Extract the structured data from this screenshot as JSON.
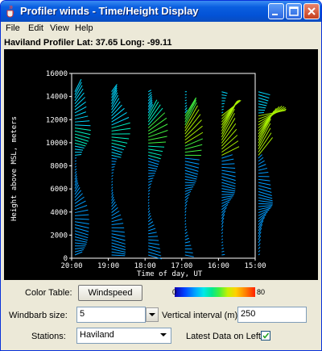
{
  "window": {
    "title": "Profiler winds - Time/Height Display"
  },
  "menu": {
    "file": "File",
    "edit": "Edit",
    "view": "View",
    "help": "Help"
  },
  "station_line": "Haviland Profiler Lat: 37.65  Long: -99.11",
  "plot": {
    "y_axis_label": "Height above MSL, meters",
    "x_axis_label": "Time of day, UT",
    "y_ticks": [
      "0",
      "2000",
      "4000",
      "6000",
      "8000",
      "10000",
      "12000",
      "14000",
      "16000"
    ],
    "x_ticks": [
      "20:00",
      "19:00",
      "18:00",
      "17:00",
      "16:00",
      "15:00"
    ],
    "axis_color": "#ffffff"
  },
  "controls": {
    "color_table_label": "Color Table:",
    "color_table_button": "Windspeed",
    "colorbar_min": "0",
    "colorbar_max": "80",
    "windbarb_label": "Windbarb size:",
    "windbarb_value": "5",
    "vertical_interval_label": "Vertical interval (m):",
    "vertical_interval_value": "250",
    "stations_label": "Stations:",
    "stations_value": "Haviland",
    "latest_data_label": "Latest Data on Left:",
    "latest_data_checked": true
  },
  "icons": {
    "app": "java-cup-icon",
    "minimize": "minimize-icon",
    "maximize": "maximize-icon",
    "close": "close-icon",
    "dropdown": "chevron-down-icon",
    "check": "checkmark-icon"
  }
}
